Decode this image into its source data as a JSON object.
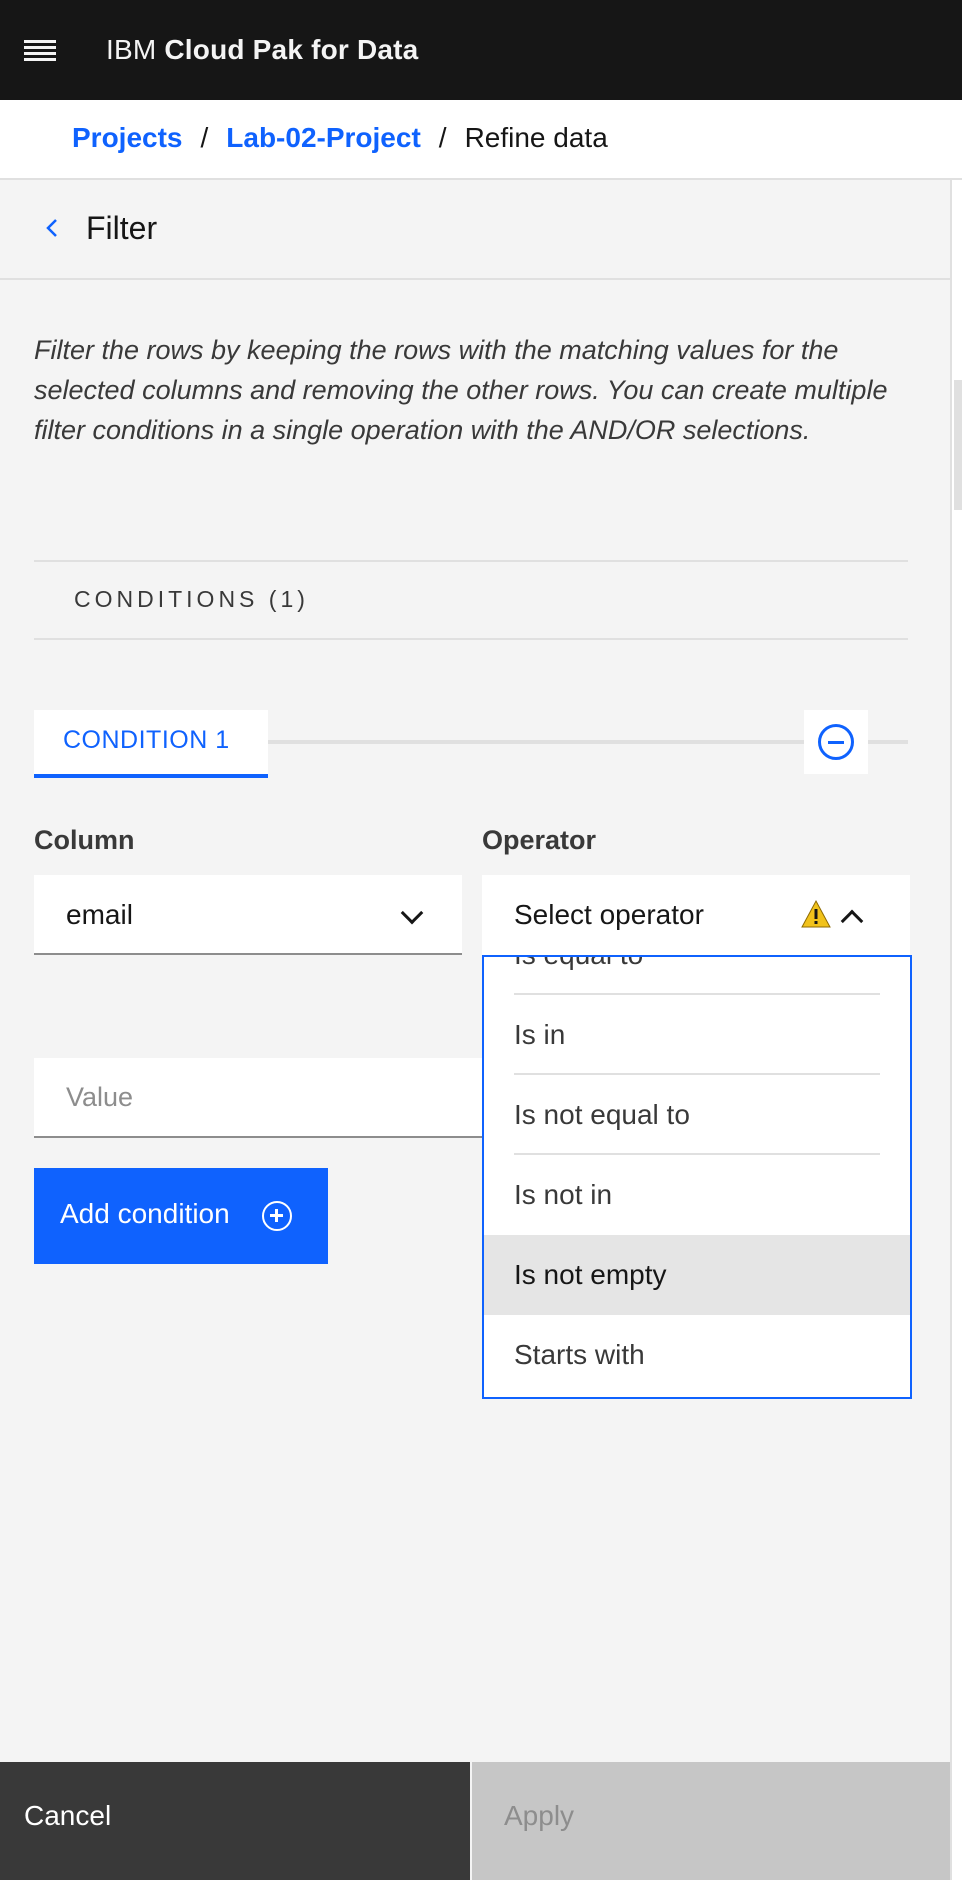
{
  "header": {
    "brand_prefix": "IBM",
    "brand_name": "Cloud Pak for Data"
  },
  "breadcrumb": {
    "items": [
      "Projects",
      "Lab-02-Project"
    ],
    "separator": "/",
    "current": "Refine data"
  },
  "panel": {
    "title": "Filter",
    "description": "Filter the rows by keeping the rows with the matching values for the selected columns and removing the other rows. You can create multiple filter conditions in a single operation with the AND/OR selections.",
    "conditions_header": "CONDITIONS (1)",
    "tab_label": "CONDITION 1",
    "column_label": "Column",
    "column_value": "email",
    "operator_label": "Operator",
    "operator_placeholder": "Select operator",
    "value_placeholder": "Value",
    "add_condition_label": "Add condition",
    "operator_options": [
      "Is equal to",
      "Is in",
      "Is not equal to",
      "Is not in",
      "Is not empty",
      "Starts with"
    ],
    "highlighted_option": "Is not empty"
  },
  "footer": {
    "cancel_label": "Cancel",
    "apply_label": "Apply"
  },
  "colors": {
    "accent": "#0f62fe",
    "header_bg": "#161616",
    "warning": "#f1c21b"
  }
}
